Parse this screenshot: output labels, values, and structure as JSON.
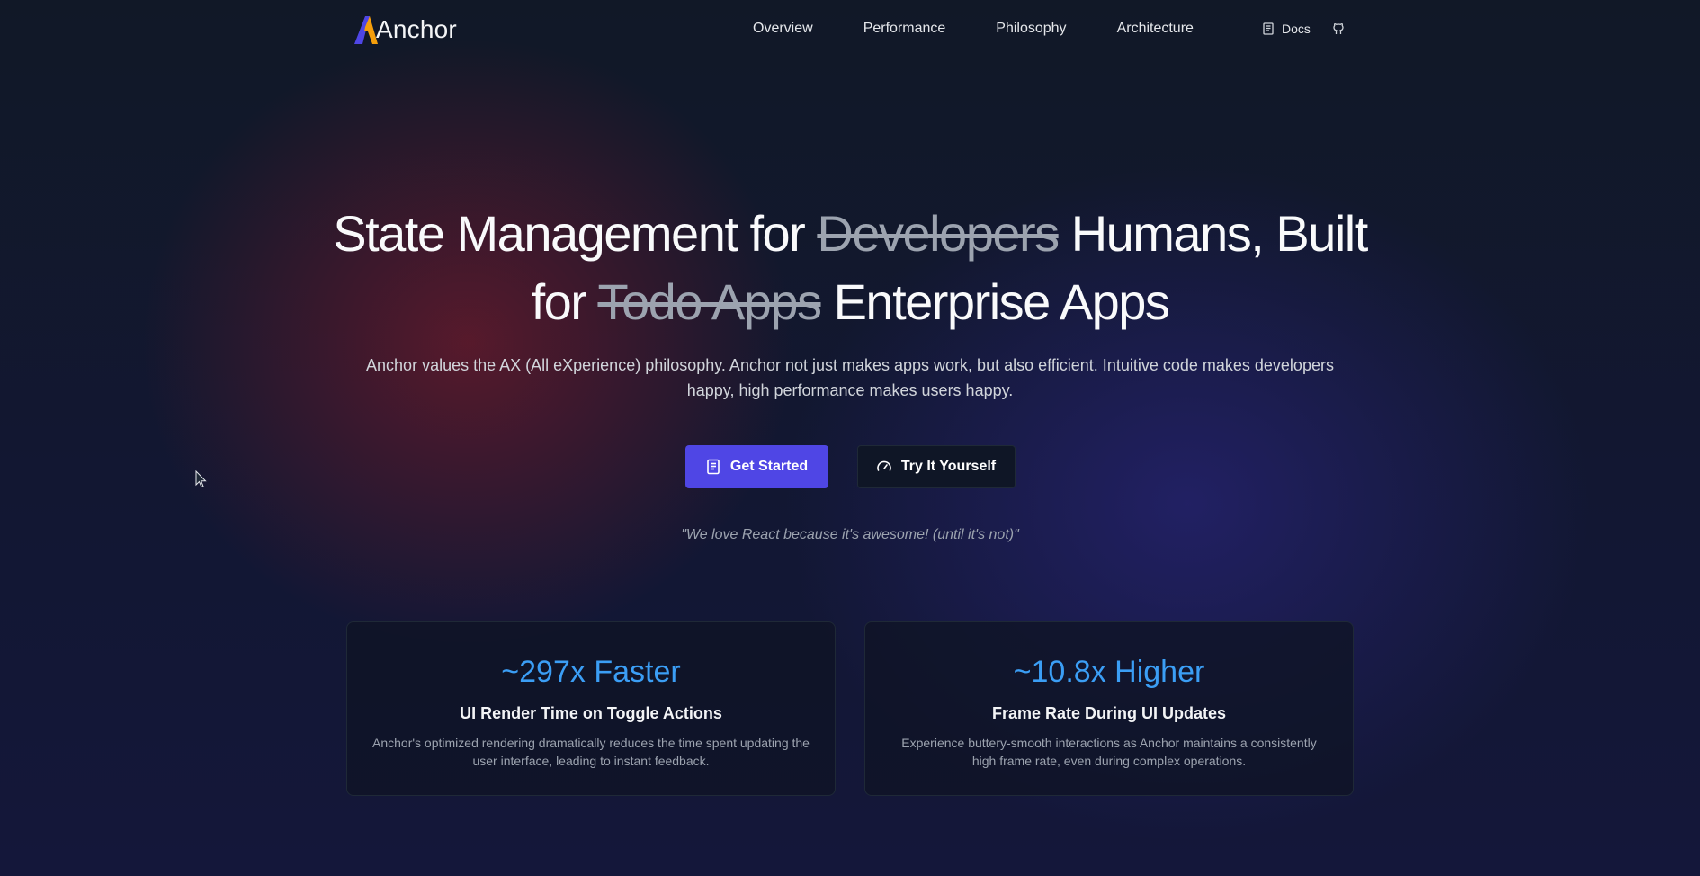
{
  "nav": {
    "brand": "Anchor",
    "brand_colors": {
      "primary": "#4f46e5",
      "accent": "#f59e0b"
    },
    "links": [
      "Overview",
      "Performance",
      "Philosophy",
      "Architecture"
    ],
    "docs_label": "Docs",
    "docs_icon": "book-icon",
    "github_icon": "github-icon"
  },
  "hero": {
    "title_part1": "State Management for ",
    "title_strike1": "Developers",
    "title_part2": " Humans, Built for ",
    "title_strike2": "Todo Apps",
    "title_part3": " Enterprise Apps",
    "subtitle": "Anchor values the AX (All eXperience) philosophy. Anchor not just makes apps work, but also efficient. Intuitive code makes developers happy, high performance makes users happy.",
    "primary_cta": "Get Started",
    "primary_cta_icon": "book-icon",
    "primary_cta_color": "#4f46e5",
    "secondary_cta": "Try It Yourself",
    "secondary_cta_icon": "gauge-icon",
    "quote": "\"We love React because it's awesome! (until it's not)\""
  },
  "stats": [
    {
      "metric": "~297x Faster",
      "title": "UI Render Time on Toggle Actions",
      "description": "Anchor's optimized rendering dramatically reduces the time spent updating the user interface, leading to instant feedback."
    },
    {
      "metric": "~10.8x Higher",
      "title": "Frame Rate During UI Updates",
      "description": "Experience buttery-smooth interactions as Anchor maintains a consistently high frame rate, even during complex operations."
    }
  ],
  "colors": {
    "metric": "#3b9ef5",
    "background": "#0f172a"
  }
}
